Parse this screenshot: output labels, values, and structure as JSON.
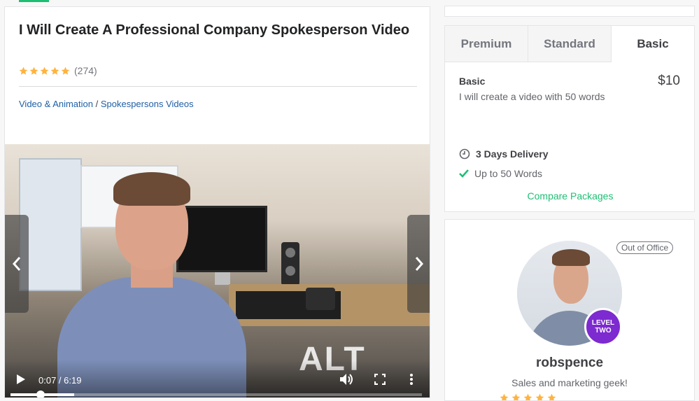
{
  "gig": {
    "title": "I Will Create A Professional Company Spokesperson Video",
    "rating_count": "(274)",
    "breadcrumb": {
      "category": "Video & Animation",
      "separator": " / ",
      "subcategory": "Spokespersons Videos"
    }
  },
  "video": {
    "watermark": "ALT",
    "time": "0:07 / 6:19",
    "progress": 0.0188
  },
  "packages": {
    "tabs": [
      "Premium",
      "Standard",
      "Basic"
    ],
    "active_tab": "Basic",
    "name": "Basic",
    "price": "$10",
    "description": "I will create a video with 50 words",
    "delivery": "3 Days Delivery",
    "feature": "Up to 50 Words",
    "compare_link": "Compare Packages"
  },
  "seller": {
    "name": "robspence",
    "tagline": "Sales and marketing geek!",
    "status_badge": "Out of Office",
    "level_badge_line1": "LEVEL",
    "level_badge_line2": "TWO"
  },
  "colors": {
    "accent_green": "#1dbf73",
    "star_yellow": "#ffb33e",
    "link_blue": "#1f5fa6",
    "level_purple": "#7d2ad0"
  },
  "icons": {
    "rating": "star-icon",
    "video_prev": "chevron-left-icon",
    "video_next": "chevron-right-icon",
    "play": "play-icon",
    "volume": "volume-icon",
    "fullscreen": "fullscreen-icon",
    "more": "more-vertical-icon",
    "delivery": "clock-icon",
    "feature": "check-icon"
  }
}
